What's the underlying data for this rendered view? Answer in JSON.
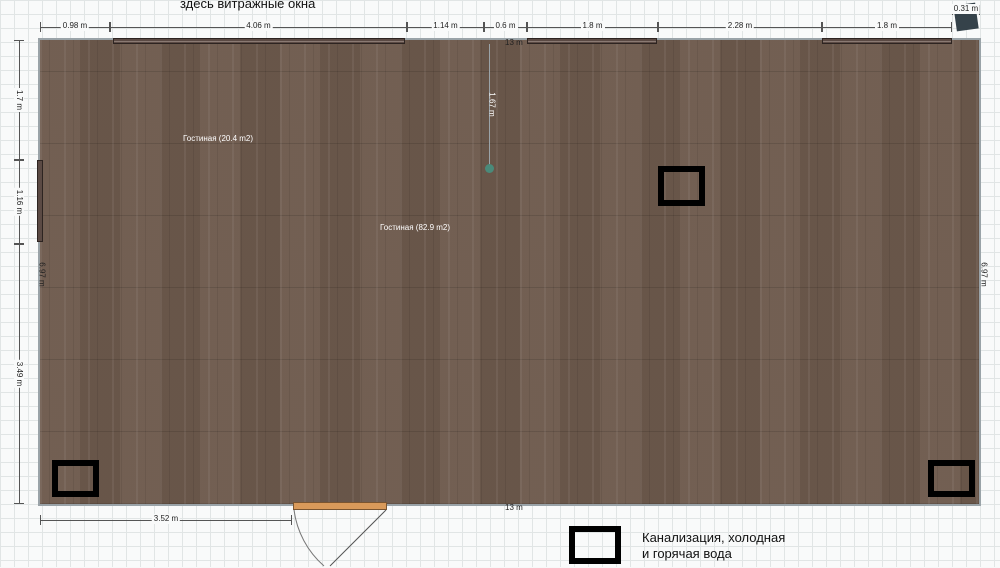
{
  "annotations": {
    "top_note": "здесь витражные окна",
    "legend_line1": "Канализация, холодная",
    "legend_line2": "и горячая вода"
  },
  "rooms": [
    {
      "label": "Гостиная (20.4 m2)"
    },
    {
      "label": "Гостиная (82.9 m2)"
    }
  ],
  "dimensions": {
    "top_segments": [
      "0.98 m",
      "4.06 m",
      "1.14 m",
      "0.6 m",
      "1.8 m",
      "2.28 m",
      "1.8 m",
      "0.31 m"
    ],
    "top_total": "13 m",
    "bottom_total": "13 m",
    "bottom_left": "3.52 m",
    "left_segments": [
      "1.7 m",
      "1.16 m",
      "3.49 m"
    ],
    "left_total": "6.97 m",
    "right_total": "6.97 m",
    "inner_vertical": "1.67 m"
  },
  "colors": {
    "floor": "#6e5a4d",
    "fixture": "#000000",
    "door": "#d99a5a"
  }
}
